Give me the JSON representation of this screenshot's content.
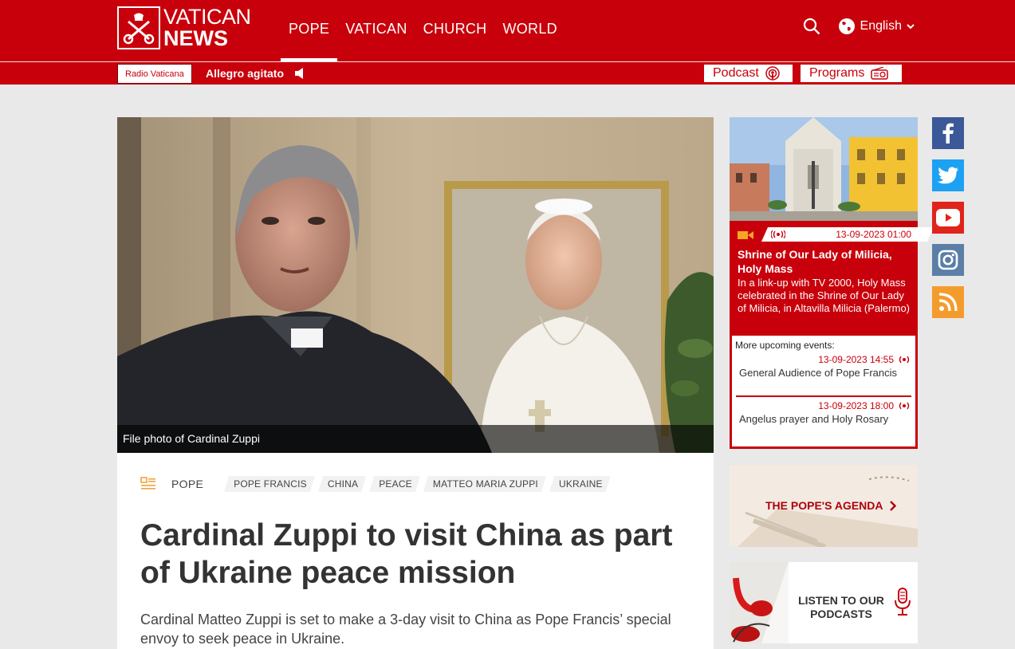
{
  "header": {
    "logo_line1": "VATICAN",
    "logo_line2": "NEWS",
    "nav": [
      {
        "label": "POPE",
        "active": true
      },
      {
        "label": "VATICAN",
        "active": false
      },
      {
        "label": "CHURCH",
        "active": false
      },
      {
        "label": "WORLD",
        "active": false
      }
    ],
    "language": "English",
    "icons": {
      "search": "search-icon",
      "globe": "globe-icon",
      "chevron": "chevron-down-icon"
    }
  },
  "radio_bar": {
    "station": "Radio Vaticana",
    "now_playing": "Allegro agitato",
    "podcast_label": "Podcast",
    "programs_label": "Programs"
  },
  "article": {
    "image_caption": "File photo of Cardinal Zuppi",
    "section": "POPE",
    "tags": [
      "POPE FRANCIS",
      "CHINA",
      "PEACE",
      "MATTEO MARIA ZUPPI",
      "UKRAINE"
    ],
    "headline": "Cardinal Zuppi to visit China as part of Ukraine peace mission",
    "lede": "Cardinal Matteo Zuppi is set to make a 3-day visit to China as Pope Francis’ special envoy to seek peace in Ukraine."
  },
  "sidebar": {
    "live": {
      "datetime": "13-09-2023 01:00",
      "title": "Shrine of Our Lady of Milicia, Holy Mass",
      "description": "In a link-up with TV 2000, Holy Mass celebrated in the Shrine of Our Lady of Milicia, in Altavilla Milicia (Palermo)",
      "upcoming_heading": "More upcoming events:",
      "upcoming": [
        {
          "datetime": "13-09-2023 14:55",
          "name": "General Audience of Pope Francis"
        },
        {
          "datetime": "13-09-2023 18:00",
          "name": "Angelus prayer and Holy Rosary"
        }
      ]
    },
    "agenda_label": "THE POPE'S AGENDA",
    "podcasts_label": "LISTEN TO OUR PODCASTS"
  },
  "social": [
    "facebook-icon",
    "twitter-icon",
    "youtube-icon",
    "instagram-icon",
    "rss-icon"
  ],
  "colors": {
    "brand_red": "#c8000b",
    "background": "#e9e9e9"
  }
}
